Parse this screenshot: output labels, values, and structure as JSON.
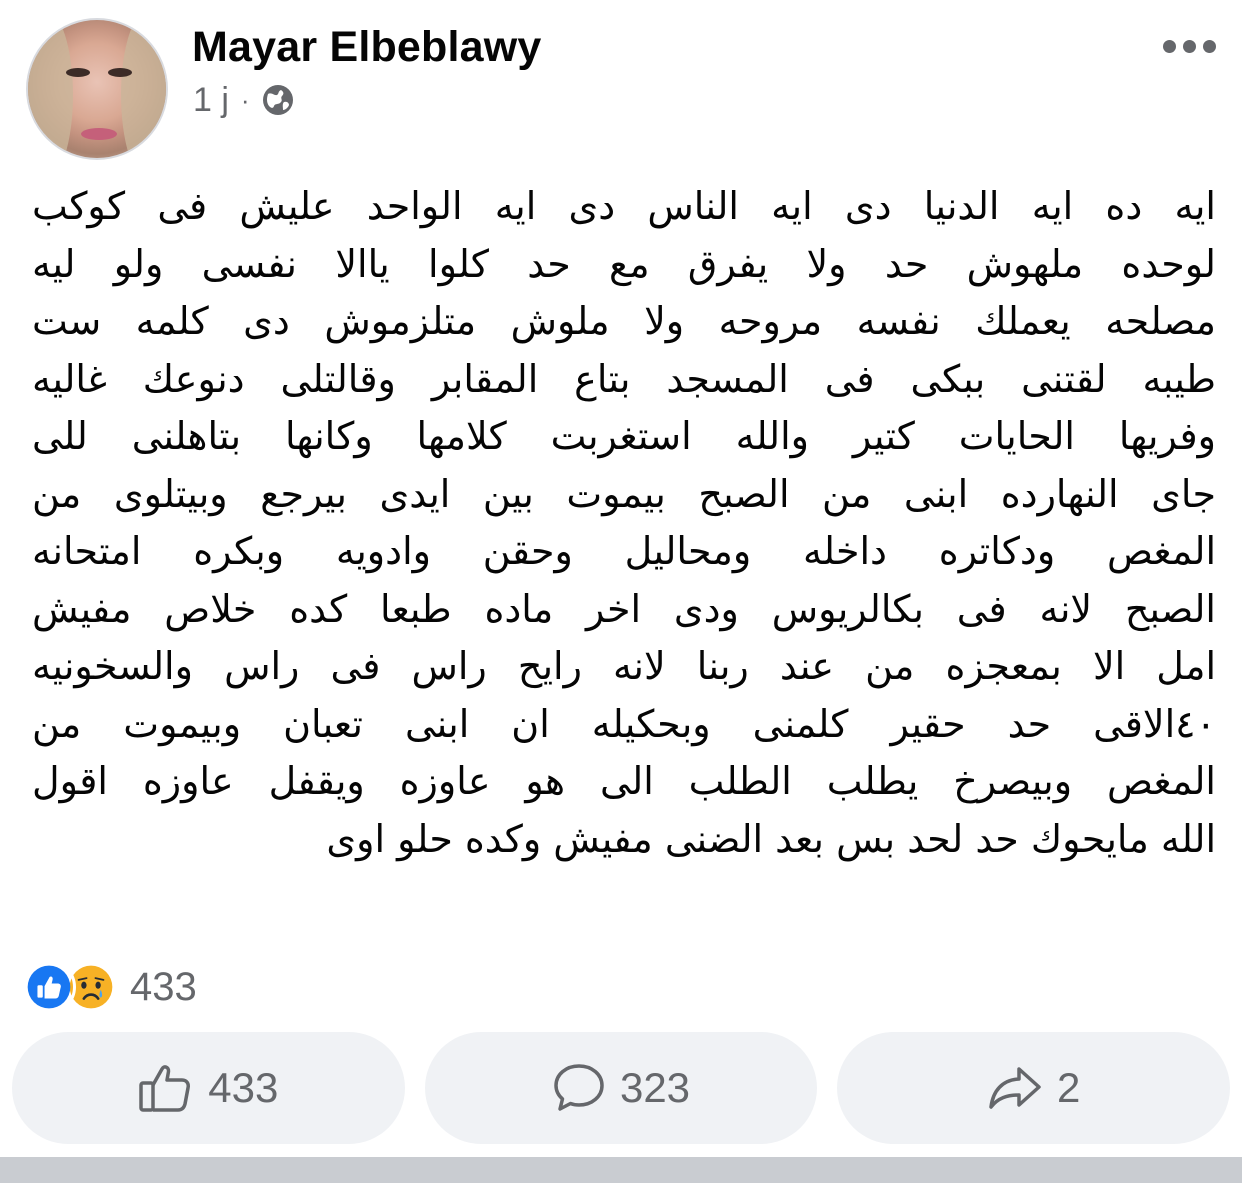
{
  "post": {
    "author": "Mayar Elbeblawy",
    "time": "1 j",
    "separator": "·",
    "audience_icon": "globe-icon",
    "more_icon": "more-horizontal-icon",
    "text_lines": [
      "ايه ده ايه الدنيا دى ايه الناس دى ايه  الواحد عليش فى كوكب",
      "لوحده ملهوش حد ولا يفرق مع حد كلوا ياالا نفسى ولو ليه",
      "مصلحه يعملك نفسه مروحه ولا ملوش متلزموش دى كلمه ست",
      "طيبه لقتنى ببكى فى المسجد بتاع المقابر وقالتلى دنوعك غاليه",
      "وفريها  الحايات كتير والله استغربت كلامها وكانها بتاهلنى للى",
      "جاى النهارده ابنى من الصبح بيموت بين ايدى بيرجع وبيتلوى من",
      "المغص ودكاتره داخله ومحاليل وحقن وادويه وبكره امتحانه",
      "الصبح لانه فى بكالريوس ودى اخر ماده طبعا كده خلاص مفيش",
      "امل الا بمعجزه من عند ربنا لانه رايح راس فى راس والسخونيه",
      "٤٠الاقى حد حقير كلمنى وبحكيله ان ابنى تعبان وبيموت من",
      "المغص وبيصرخ يطلب الطلب الى هو عاوزه ويقفل  عاوزه اقول",
      "الله مايحوك حد لحد بس بعد الضنى مفيش  وكده حلو اوى"
    ]
  },
  "reactions": {
    "icons": [
      "like-reaction-icon",
      "sad-reaction-icon"
    ],
    "count": "433",
    "like_color": "#1877f2",
    "sad_color": "#f7b125"
  },
  "actions": {
    "like": {
      "icon": "thumbs-up-icon",
      "count": "433"
    },
    "comment": {
      "icon": "comment-icon",
      "count": "323"
    },
    "share": {
      "icon": "share-icon",
      "count": "2"
    }
  }
}
